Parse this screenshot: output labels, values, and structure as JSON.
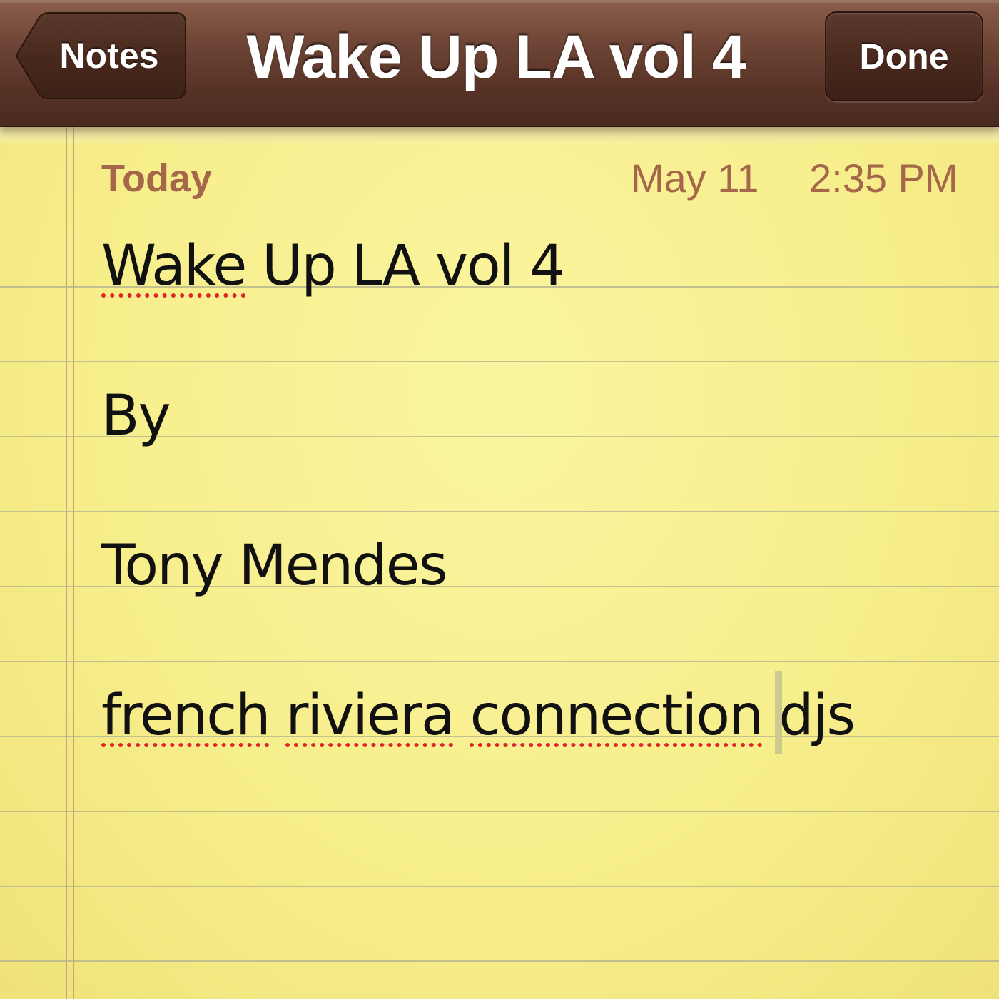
{
  "navbar": {
    "back_label": "Notes",
    "title": "Wake Up LA vol 4",
    "done_label": "Done"
  },
  "note": {
    "date_label": "Today",
    "date": "May 11",
    "time": "2:35 PM",
    "lines": [
      {
        "segments": [
          {
            "text": "Wake",
            "misspelled": true
          },
          {
            "text": " Up LA vol 4",
            "misspelled": false
          }
        ]
      },
      {
        "segments": [
          {
            "text": "By",
            "misspelled": false
          }
        ]
      },
      {
        "segments": [
          {
            "text": "Tony Mendes",
            "misspelled": false
          }
        ]
      },
      {
        "segments": [
          {
            "text": "french",
            "misspelled": true
          },
          {
            "text": " ",
            "misspelled": false
          },
          {
            "text": "riviera",
            "misspelled": true
          },
          {
            "text": " ",
            "misspelled": false
          },
          {
            "text": "connection",
            "misspelled": true
          },
          {
            "text": " djs",
            "misspelled": false
          }
        ]
      }
    ]
  },
  "colors": {
    "navbar": "#573326",
    "paper": "#f7ee8c",
    "date_text": "#a5674a",
    "note_text": "#111111",
    "spellcheck_underline": "#e0242a"
  }
}
